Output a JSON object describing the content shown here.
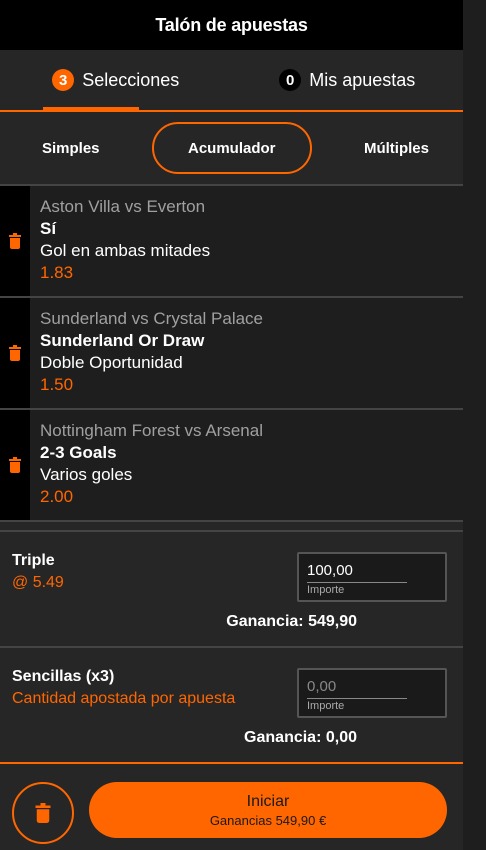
{
  "header": {
    "title": "Talón de apuestas"
  },
  "tabs": [
    {
      "count": "3",
      "label": "Selecciones"
    },
    {
      "count": "0",
      "label": "Mis apuestas"
    }
  ],
  "modes": [
    "Simples",
    "Acumulador",
    "Múltiples"
  ],
  "selections": [
    {
      "match": "Aston Villa vs Everton",
      "pick": "Sí",
      "market": "Gol en ambas mitades",
      "odds": "1.83"
    },
    {
      "match": "Sunderland vs Crystal Palace",
      "pick": "Sunderland Or Draw",
      "market": "Doble Oportunidad",
      "odds": "1.50"
    },
    {
      "match": "Nottingham Forest vs Arsenal",
      "pick": "2-3 Goals",
      "market": "Varios goles",
      "odds": "2.00"
    }
  ],
  "triple": {
    "title": "Triple",
    "odds": "@ 5.49",
    "amount": "100,00",
    "amount_label": "Importe",
    "gain_label": "Ganancia:",
    "gain_value": "549,90"
  },
  "singles": {
    "title": "Sencillas (x3)",
    "subtitle": "Cantidad apostada por apuesta",
    "amount": "0,00",
    "amount_label": "Importe",
    "gain_label": "Ganancia:",
    "gain_value": "0,00"
  },
  "footer": {
    "start_label": "Iniciar",
    "start_sub": "Ganancias 549,90 €"
  },
  "colors": {
    "accent": "#ff6600",
    "background": "#262626",
    "header": "#000000"
  }
}
